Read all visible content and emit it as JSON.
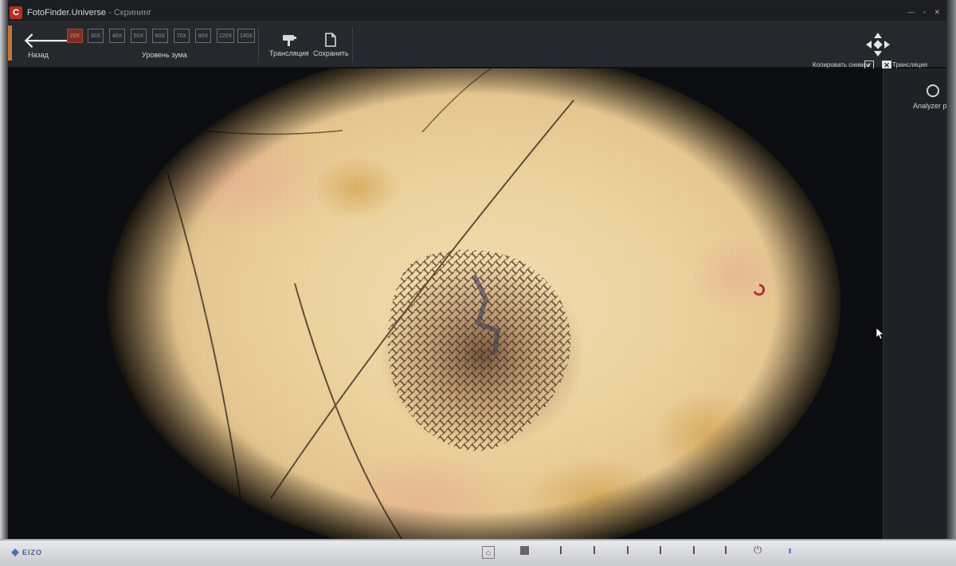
{
  "window": {
    "app_name": "FotoFinder.Universe",
    "separator": " - ",
    "mode": "Скрининг"
  },
  "toolbar": {
    "back_label": "Назад",
    "zoom_levels": [
      "20X",
      "30X",
      "40X",
      "50X",
      "60X",
      "70X",
      "90X",
      "120X",
      "140X"
    ],
    "active_zoom": "20X",
    "zoom_label": "Уровень зума",
    "broadcast_label": "Трансляция",
    "save_label": "Сохранить",
    "copy_snapshot_label": "Копировать снимок",
    "copy_snapshot_checked": true,
    "broadcast_toggle_label": "Трансляция",
    "broadcast_toggle_state": "x"
  },
  "side_panel": {
    "analyzer_label": "Analyzer pro"
  },
  "monitor": {
    "brand": "EIZO"
  },
  "colors": {
    "accent": "#c4773a",
    "active_zoom_bg": "#7b2e24",
    "toolbar_bg": "#25282c"
  }
}
